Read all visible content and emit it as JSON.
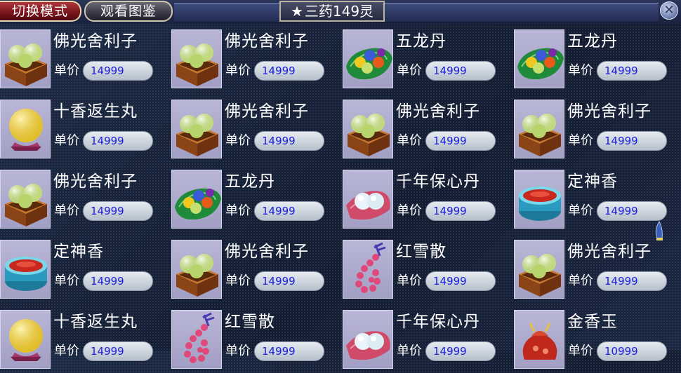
{
  "toolbar": {
    "mode_label": "切换模式",
    "atlas_label": "观看图鉴",
    "title_star": "★",
    "title": "三药149灵",
    "close_icon": "close-icon"
  },
  "price_label": "单价",
  "items": [
    {
      "name": "佛光舍利子",
      "price": "14999",
      "icon": "buddha-relic"
    },
    {
      "name": "佛光舍利子",
      "price": "14999",
      "icon": "buddha-relic"
    },
    {
      "name": "五龙丹",
      "price": "14999",
      "icon": "five-dragon-pill"
    },
    {
      "name": "五龙丹",
      "price": "14999",
      "icon": "five-dragon-pill"
    },
    {
      "name": "十香返生丸",
      "price": "14999",
      "icon": "revival-pill"
    },
    {
      "name": "佛光舍利子",
      "price": "14999",
      "icon": "buddha-relic"
    },
    {
      "name": "佛光舍利子",
      "price": "14999",
      "icon": "buddha-relic"
    },
    {
      "name": "佛光舍利子",
      "price": "14999",
      "icon": "buddha-relic"
    },
    {
      "name": "佛光舍利子",
      "price": "14999",
      "icon": "buddha-relic"
    },
    {
      "name": "五龙丹",
      "price": "14999",
      "icon": "five-dragon-pill"
    },
    {
      "name": "千年保心丹",
      "price": "14999",
      "icon": "heart-pill"
    },
    {
      "name": "定神香",
      "price": "14999",
      "icon": "incense-bowl"
    },
    {
      "name": "定神香",
      "price": "14999",
      "icon": "incense-bowl"
    },
    {
      "name": "佛光舍利子",
      "price": "14999",
      "icon": "buddha-relic"
    },
    {
      "name": "红雪散",
      "price": "14999",
      "icon": "red-snow-beads"
    },
    {
      "name": "佛光舍利子",
      "price": "14999",
      "icon": "buddha-relic"
    },
    {
      "name": "十香返生丸",
      "price": "14999",
      "icon": "revival-pill"
    },
    {
      "name": "红雪散",
      "price": "14999",
      "icon": "red-snow-beads"
    },
    {
      "name": "千年保心丹",
      "price": "14999",
      "icon": "heart-pill"
    },
    {
      "name": "金香玉",
      "price": "10999",
      "icon": "golden-jade-pouch"
    }
  ]
}
